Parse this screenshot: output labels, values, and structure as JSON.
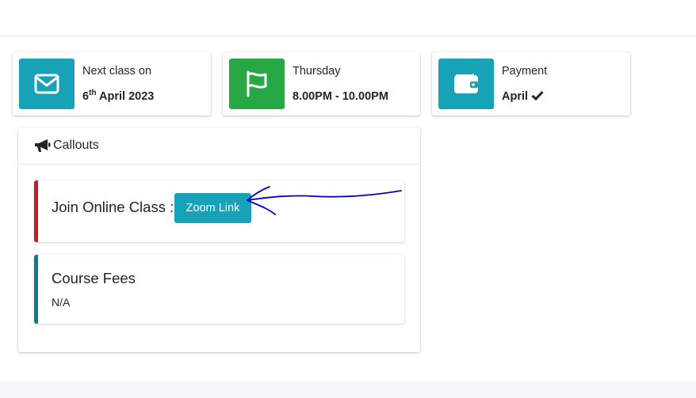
{
  "info_boxes": [
    {
      "label": "Next class on",
      "value_day": "6",
      "value_suffix": "th",
      "value_rest": " April 2023",
      "icon": "envelope-icon",
      "color": "#17a2b8"
    },
    {
      "label": "Thursday",
      "value": "8.00PM - 10.00PM",
      "icon": "flag-icon",
      "color": "#28a745"
    },
    {
      "label": "Payment",
      "value": "April",
      "icon": "wallet-icon",
      "status_icon": "checkmark-icon",
      "color": "#17a2b8"
    }
  ],
  "callouts_card": {
    "title": "Callouts",
    "icon": "megaphone-icon",
    "join": {
      "label": "Join Online Class :",
      "button_label": "Zoom Link",
      "button_color": "#17a2b8",
      "border_color": "#bd2130"
    },
    "fees": {
      "title": "Course Fees",
      "value": "N/A",
      "border_color": "#117a8b"
    }
  },
  "annotation": {
    "type": "hand-drawn-arrow",
    "color": "#0000cc",
    "points_to": "Zoom Link"
  }
}
